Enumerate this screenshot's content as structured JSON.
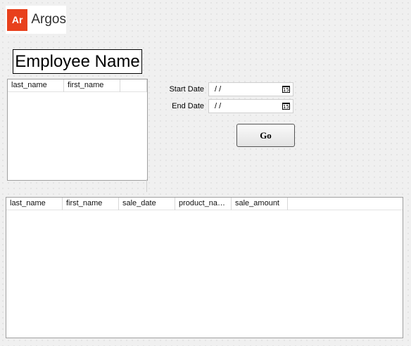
{
  "logo": {
    "mark": "Ar",
    "name": "Argos",
    "accent": "#e8401c"
  },
  "title": "Employee Name",
  "employee_grid": {
    "columns": [
      "last_name",
      "first_name",
      ""
    ]
  },
  "filters": {
    "start_label": "Start Date",
    "start_value": "/ /",
    "end_label": "End Date",
    "end_value": "/ /",
    "calendar_icon_text": "15"
  },
  "go_button": "Go",
  "sales_grid": {
    "columns": [
      "last_name",
      "first_name",
      "sale_date",
      "product_na…",
      "sale_amount",
      ""
    ]
  }
}
